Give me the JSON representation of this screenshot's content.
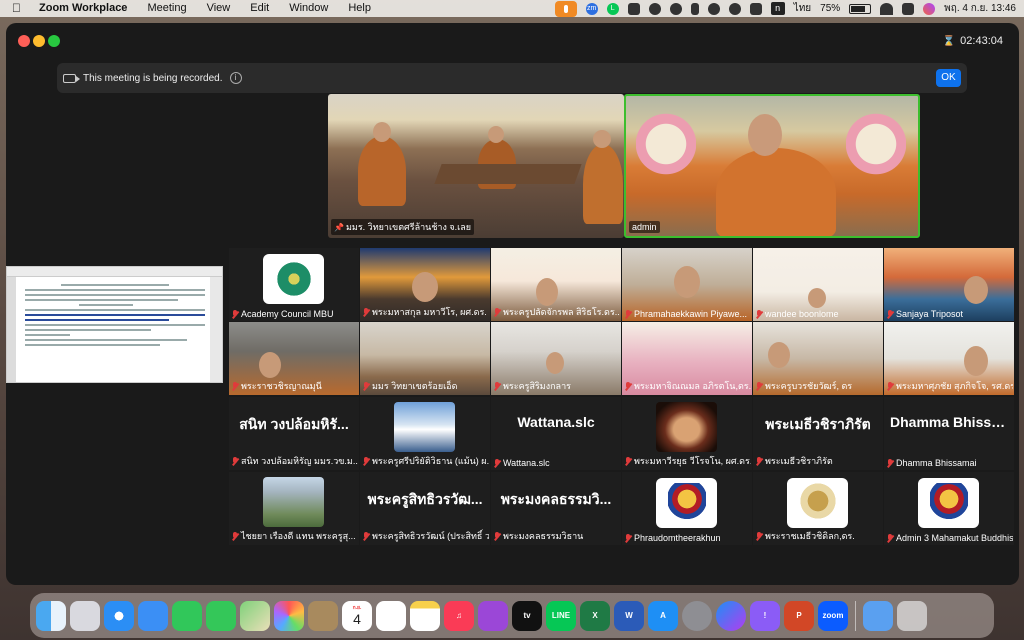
{
  "menubar": {
    "app_name": "Zoom Workplace",
    "items": [
      "Meeting",
      "View",
      "Edit",
      "Window",
      "Help"
    ],
    "status": {
      "lang": "ไทย",
      "battery": "75%",
      "datetime": "พฤ. 4 ก.ย.  13:46",
      "n_badge": "n"
    }
  },
  "window": {
    "elapsed_time": "02:43:04",
    "recording_notice": "This meeting is being recorded.",
    "ok_label": "OK"
  },
  "speakers": [
    {
      "name": "มมร. วิทยาเขตศรีล้านช้าง จ.เลย"
    },
    {
      "name": "admin"
    }
  ],
  "gallery": [
    {
      "name": "Academy Council MBU",
      "kind": "logo",
      "logo": "academy-council-logo"
    },
    {
      "name": "พระมหาสกุล มหาวีโร, ผศ.ดร.",
      "kind": "video"
    },
    {
      "name": "พระครูปลัดจักรพล สิริธโร.ดร....",
      "kind": "video"
    },
    {
      "name": "Phramahaekkawin Piyawe...",
      "kind": "video"
    },
    {
      "name": "wandee boonlome",
      "kind": "video"
    },
    {
      "name": "Sanjaya Triposot",
      "kind": "video"
    },
    {
      "name": "พระราชวชิรญาณมุนี",
      "kind": "video"
    },
    {
      "name": "มมร วิทยาเขตร้อยเอ็ด",
      "kind": "video"
    },
    {
      "name": "พระครูสิริมงกลาร",
      "kind": "video"
    },
    {
      "name": "พระมหาจิณณมล อภิรตโน,ดร....",
      "kind": "video"
    },
    {
      "name": "พระครูบวรชัยวัฒร์, ดร",
      "kind": "video"
    },
    {
      "name": "พระมหาศุภชัย สุภกิจโจ, รศ.ดร.",
      "kind": "video"
    },
    {
      "name": "สนิท  วงปล้อมหิรัญ มมร.วข.ม...",
      "kind": "text",
      "display": "สนิท  วงปล้อมหิรั..."
    },
    {
      "name": "พระครูศรีปริยัติวิธาน (แม้น) ผ...",
      "kind": "picture",
      "logo": "mountain-picture"
    },
    {
      "name": "Wattana.slc",
      "kind": "text",
      "display": "Wattana.slc"
    },
    {
      "name": "พระมหาวีรยุธ วีโรจโน, ผศ.ดร.",
      "kind": "picture",
      "logo": "buddha-picture"
    },
    {
      "name": "พระเมธีวชิราภิรัต",
      "kind": "text",
      "display": "พระเมธีวชิราภิรัต"
    },
    {
      "name": "Dhamma Bhissamai",
      "kind": "text",
      "display": "Dhamma Bhissa..."
    },
    {
      "name": "ไชยยา  เรืองดี  แทน  พระครูสุ...",
      "kind": "picture",
      "logo": "building-picture"
    },
    {
      "name": "พระครูสิทธิวรวัฒน์ (ประสิทธิ์ ว...",
      "kind": "text",
      "display": "พระครูสิทธิวรวัฒ..."
    },
    {
      "name": "พระมงคลธรรมวิธาน",
      "kind": "text",
      "display": "พระมงคลธรรมวิ..."
    },
    {
      "name": "Phraudomtheerakhun",
      "kind": "logo",
      "logo": "mbu-logo"
    },
    {
      "name": "พระราชเมธีวชิดิลก,ดร.",
      "kind": "logo",
      "logo": "seal-logo"
    },
    {
      "name": "Admin 3 Mahamakut Buddhis...",
      "kind": "logo",
      "logo": "mbu-logo"
    }
  ],
  "dock": {
    "calendar_month": "ก.ย.",
    "calendar_day": "4",
    "apps": [
      "Finder",
      "Launchpad",
      "Safari",
      "Mail",
      "FaceTime",
      "Messages",
      "Maps",
      "Photos",
      "Contacts",
      "Calendar",
      "Reminders",
      "Notes",
      "Music",
      "Podcasts",
      "TV",
      "LINE",
      "Excel",
      "Word",
      "App Store",
      "System Settings",
      "Messenger",
      "Feedback",
      "PowerPoint",
      "Zoom",
      "Downloads",
      "Trash"
    ],
    "zoom_label": "zoom"
  }
}
